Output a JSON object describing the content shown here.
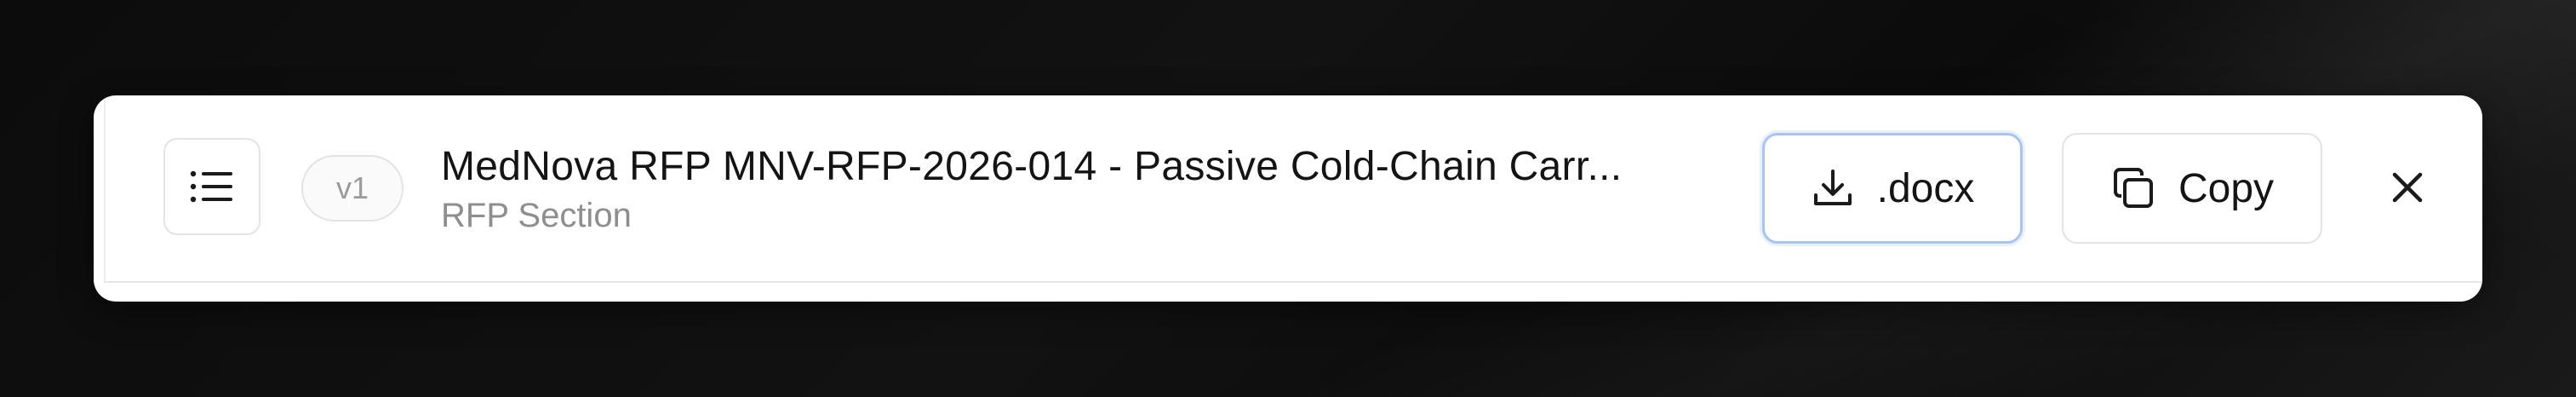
{
  "toolbar": {
    "version": "v1",
    "title": "MedNova RFP MNV-RFP-2026-014 - Passive Cold-Chain Carr...",
    "subtitle": "RFP Section",
    "download_label": ".docx",
    "copy_label": "Copy"
  },
  "icons": {
    "menu": "list-icon",
    "download": "download-icon",
    "copy": "copy-icon",
    "close": "close-icon"
  },
  "colors": {
    "background": "#0a0a0a",
    "panel": "#ffffff",
    "title_text": "#141414",
    "muted_text": "#8e8e8e",
    "focus_ring": "#a9c3f4"
  }
}
